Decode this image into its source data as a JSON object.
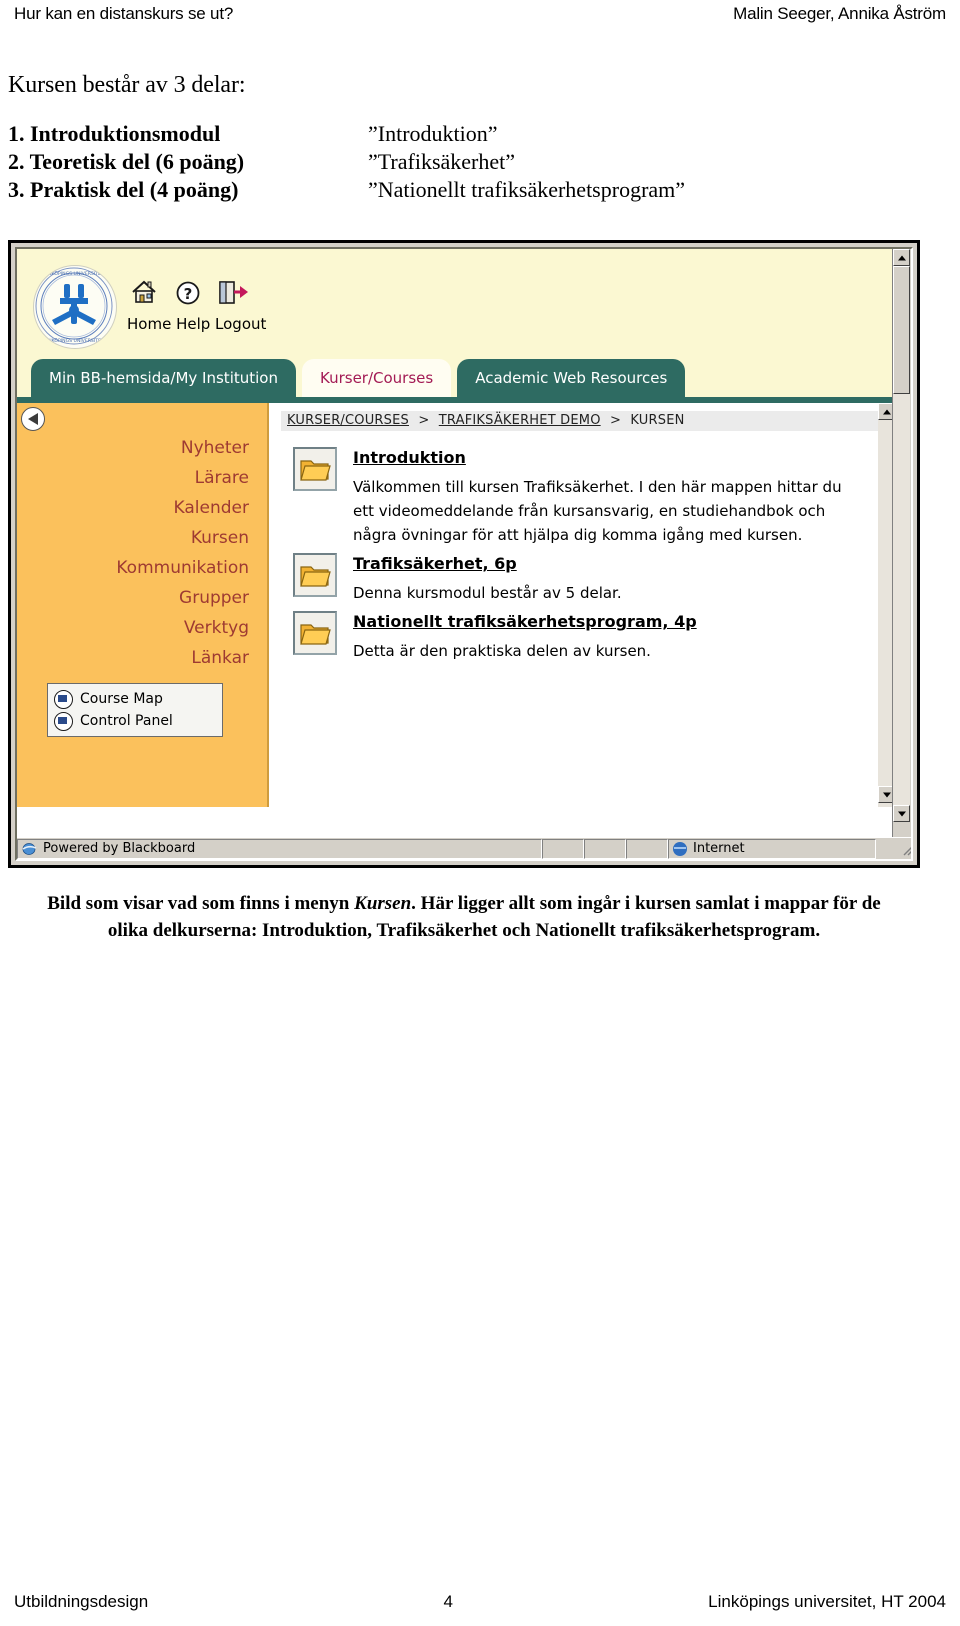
{
  "header": {
    "left": "Hur kan en distanskurs se ut?",
    "right": "Malin Seeger, Annika Åström"
  },
  "intro": {
    "title": "Kursen består av 3 delar:",
    "parts": [
      {
        "num": "1. Introduktionsmodul",
        "name": "”Introduktion”"
      },
      {
        "num": "2. Teoretisk del (6 poäng)",
        "name": "”Trafiksäkerhet”"
      },
      {
        "num": "3. Praktisk del (4 poäng)",
        "name": "”Nationellt trafiksäkerhetsprogram”"
      }
    ]
  },
  "browser": {
    "blackboard": {
      "logo_alt": "liu-logo",
      "top_icons": [
        {
          "name": "home-icon",
          "label": "Home"
        },
        {
          "name": "help-icon",
          "label": "Help"
        },
        {
          "name": "logout-icon",
          "label": "Logout"
        }
      ],
      "top_labels": "Home Help Logout",
      "tabs": [
        {
          "label": "Min BB-hemsida/My Institution",
          "active": false
        },
        {
          "label": "Kurser/Courses",
          "active": true
        },
        {
          "label": "Academic Web Resources",
          "active": false
        }
      ],
      "nav": {
        "items": [
          "Nyheter",
          "Lärare",
          "Kalender",
          "Kursen",
          "Kommunikation",
          "Grupper",
          "Verktyg",
          "Länkar"
        ],
        "panel": [
          {
            "icon": "course-map-icon",
            "label": "Course Map"
          },
          {
            "icon": "control-panel-icon",
            "label": "Control Panel"
          }
        ]
      },
      "breadcrumb": [
        {
          "label": "KURSER/COURSES",
          "link": true
        },
        {
          "label": "TRAFIKSÄKERHET DEMO",
          "link": true
        },
        {
          "label": "KURSEN",
          "link": false
        }
      ],
      "breadcrumb_separator": ">",
      "content_items": [
        {
          "title": "Introduktion",
          "desc": "Välkommen till kursen Trafiksäkerhet. I den här mappen hittar du ett videomeddelande från kursansvarig, en studiehandbok och några övningar för att hjälpa dig komma igång med kursen."
        },
        {
          "title": "Trafiksäkerhet, 6p",
          "desc": "Denna kursmodul består av 5 delar."
        },
        {
          "title": "Nationellt trafiksäkerhetsprogram, 4p",
          "desc": "Detta är den praktiska delen av kursen."
        }
      ],
      "statusbar": {
        "powered": "Powered by Blackboard",
        "zone": "Internet"
      }
    },
    "colors": {
      "tab_active_bg": "#fffdf2",
      "tab_active_text": "#a31b55",
      "tab_inactive_bg": "#2e6b62",
      "header_bg": "#fbf8d2",
      "nav_bg": "#fbc15c",
      "nav_text": "#9e3a32",
      "folder": "#f2b233"
    }
  },
  "caption": {
    "line1_before": "Bild som visar vad som finns i menyn ",
    "line1_em": "Kursen",
    "line1_after": ". Här ligger allt som ingår i kursen samlat i mappar för de",
    "line2": "olika delkurserna: Introduktion, Trafiksäkerhet och Nationellt trafiksäkerhetsprogram."
  },
  "footer": {
    "left": "Utbildningsdesign",
    "page": "4",
    "right": "Linköpings universitet, HT 2004"
  }
}
